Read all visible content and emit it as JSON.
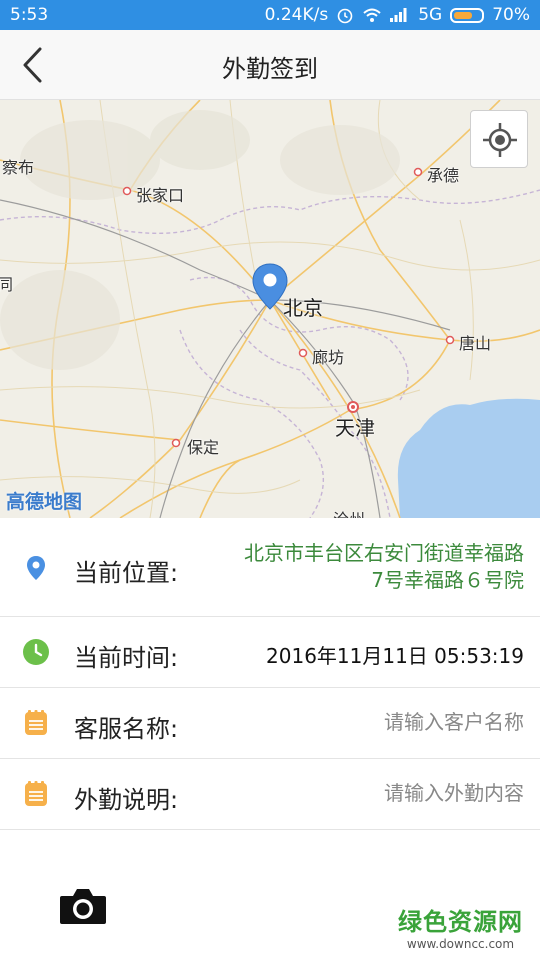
{
  "status_bar": {
    "time": "5:53",
    "network_speed": "0.24K/s",
    "network_type": "5G",
    "battery": "70%",
    "battery_level": 0.7
  },
  "header": {
    "title": "外勤签到",
    "back_icon": "chevron-left-icon"
  },
  "map": {
    "cities": {
      "zhangjiakou": "张家口",
      "chengde": "承德",
      "beijing": "北京",
      "langfang": "廊坊",
      "tangshan": "唐山",
      "tianjin": "天津",
      "baoding": "保定",
      "chabu_partial": "察布",
      "left_edge_partial": "同",
      "bottom_partial": "沧州"
    },
    "logo": "高德地图",
    "locate_icon": "crosshair-icon",
    "marker_icon": "location-pin-icon"
  },
  "form": {
    "location": {
      "label": "当前位置:",
      "value_line1": "北京市丰台区右安门街道幸福路",
      "value_line2": "7号幸福路６号院",
      "icon": "location-pin-icon"
    },
    "time": {
      "label": "当前时间:",
      "value": "2016年11月11日 05:53:19",
      "icon": "clock-icon"
    },
    "customer": {
      "label": "客服名称:",
      "placeholder": "请输入客户名称",
      "value": "",
      "icon": "notepad-icon"
    },
    "note": {
      "label": "外勤说明:",
      "placeholder": "请输入外勤内容",
      "value": "",
      "icon": "notepad-icon"
    }
  },
  "camera_icon": "camera-icon",
  "watermark": {
    "title": "绿色资源网",
    "url": "www.downcc.com"
  },
  "colors": {
    "status_bar": "#2f8fe3",
    "address_text": "#3c8a3c",
    "clock_icon": "#6cc04a",
    "notepad_icon": "#f6b04a",
    "pin_icon": "#4a90e2"
  }
}
